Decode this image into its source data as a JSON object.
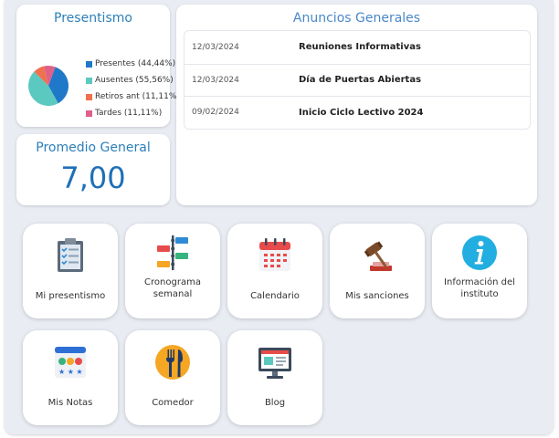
{
  "presentismo": {
    "title": "Presentismo",
    "legend": [
      {
        "label": "Presentes (44,44%)",
        "color": "#1f78c8",
        "value": 44.44
      },
      {
        "label": "Ausentes (55,56%)",
        "color": "#5cc9c0",
        "value": 55.56
      },
      {
        "label": "Retiros ant (11,11%)",
        "color": "#f07050",
        "value": 11.11
      },
      {
        "label": "Tardes (11,11%)",
        "color": "#e06088",
        "value": 11.11
      }
    ]
  },
  "promedio": {
    "title": "Promedio General",
    "value": "7,00"
  },
  "anuncios": {
    "title": "Anuncios Generales",
    "rows": [
      {
        "date": "12/03/2024",
        "title": "Reuniones Informativas"
      },
      {
        "date": "12/03/2024",
        "title": "Día de Puertas Abiertas"
      },
      {
        "date": "09/02/2024",
        "title": "Inicio Ciclo Lectivo 2024"
      }
    ]
  },
  "tiles": [
    {
      "label": "Mi presentismo",
      "icon": "clipboard-checklist-icon"
    },
    {
      "label": "Cronograma semanal",
      "icon": "timeline-icon"
    },
    {
      "label": "Calendario",
      "icon": "calendar-icon"
    },
    {
      "label": "Mis sanciones",
      "icon": "gavel-icon"
    },
    {
      "label": "Información del instituto",
      "icon": "info-icon"
    },
    {
      "label": "Mis Notas",
      "icon": "grades-report-icon"
    },
    {
      "label": "Comedor",
      "icon": "fork-knife-icon"
    },
    {
      "label": "Blog",
      "icon": "blog-monitor-icon"
    }
  ]
}
